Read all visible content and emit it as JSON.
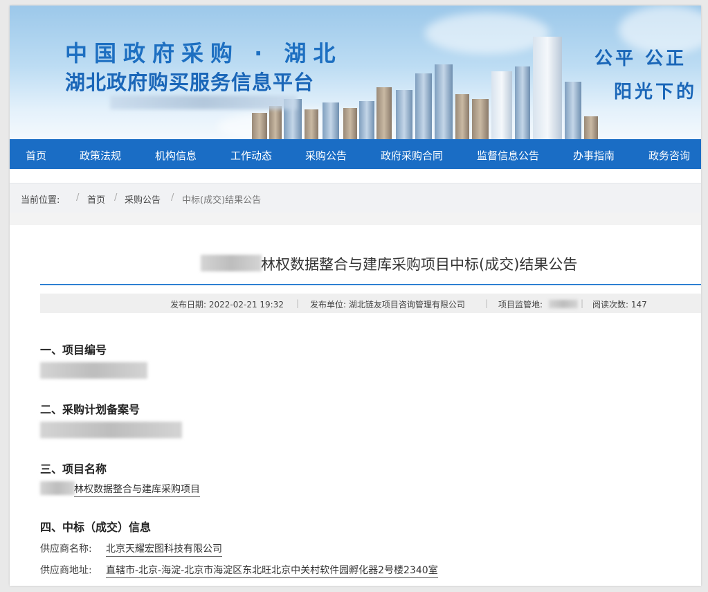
{
  "banner": {
    "title_line1": "中国政府采购 · 湖北",
    "title_line2": "湖北政府购买服务信息平台",
    "slogan_line1": "公平  公正",
    "slogan_line2": "阳光下的"
  },
  "nav": {
    "items": [
      "首页",
      "政策法规",
      "机构信息",
      "工作动态",
      "采购公告",
      "政府采购合同",
      "监督信息公告",
      "办事指南",
      "政务咨询"
    ]
  },
  "breadcrumb": {
    "label": "当前位置:",
    "separator": "/",
    "items": [
      "首页",
      "采购公告",
      "中标(成交)结果公告"
    ]
  },
  "article": {
    "title": "林权数据整合与建库采购项目中标(成交)结果公告",
    "meta": {
      "publish_date": "发布日期: 2022-02-21 19:32",
      "publisher": "发布单位: 湖北链友项目咨询管理有限公司",
      "supervisor_label": "项目监管地:",
      "read_count": "阅读次数:  147",
      "divider": "|"
    },
    "sections": [
      {
        "heading": "一、项目编号"
      },
      {
        "heading": "二、采购计划备案号"
      },
      {
        "heading": "三、项目名称",
        "value": "林权数据整合与建库采购项目"
      },
      {
        "heading": "四、中标（成交）信息"
      }
    ],
    "supplier_name_label": "供应商名称:",
    "supplier_name": "北京天耀宏图科技有限公司",
    "supplier_address_label": "供应商地址:",
    "supplier_address": "直辖市-北京-海淀-北京市海淀区东北旺北京中关村软件园孵化器2号楼2340室"
  },
  "colors": {
    "brand_blue": "#1a6dc5",
    "title_blue": "#1d6fc1",
    "rule_blue": "#2e80d2"
  }
}
